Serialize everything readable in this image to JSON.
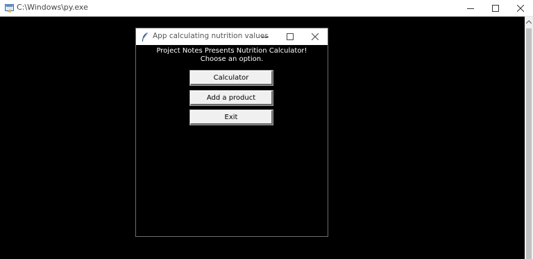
{
  "console": {
    "title": "C:\\Windows\\py.exe"
  },
  "app": {
    "title": "App calculating nutrition values",
    "headline_line1": "Project Notes Presents Nutrition Calculator!",
    "headline_line2": "Choose an option.",
    "buttons": {
      "calculator": "Calculator",
      "add_product": "Add a product",
      "exit": "Exit"
    }
  },
  "icons": {
    "console_app": "python-launcher-icon",
    "tk_app": "feather-icon",
    "minimize": "minimize-icon",
    "maximize": "maximize-icon",
    "close": "close-icon",
    "scroll_up": "scroll-up-arrow-icon"
  },
  "colors": {
    "background": "#000000",
    "titlebar": "#ffffff",
    "button_face": "#f0f0f0",
    "text_light": "#ffffff"
  }
}
